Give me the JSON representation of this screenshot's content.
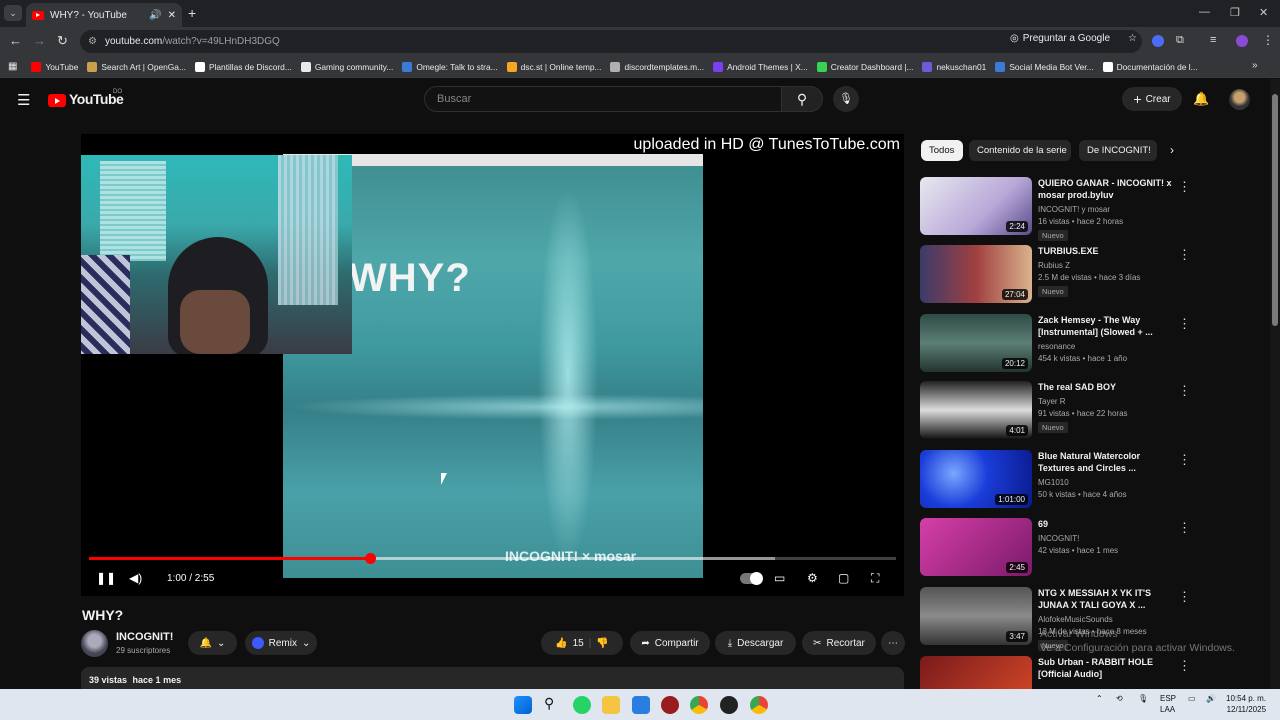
{
  "browser": {
    "tab_title": "WHY? - YouTube",
    "url_host": "youtube.com",
    "url_path": "/watch?v=49LHnDH3DGQ",
    "ask_google": "Preguntar a Google"
  },
  "bookmarks": [
    {
      "label": "YouTube",
      "color": "#ff0000"
    },
    {
      "label": "Search Art | OpenGa...",
      "color": "#c9a14a"
    },
    {
      "label": "Plantillas de Discord...",
      "color": "#ffffff"
    },
    {
      "label": "Gaming community...",
      "color": "#e8eaed"
    },
    {
      "label": "Omegle: Talk to stra...",
      "color": "#3a7bd5"
    },
    {
      "label": "dsc.st | Online temp...",
      "color": "#f5a623"
    },
    {
      "label": "discordtemplates.m...",
      "color": "#b0b0b0"
    },
    {
      "label": "Android Themes | X...",
      "color": "#7b3ff2"
    },
    {
      "label": "Creator Dashboard |...",
      "color": "#39d353"
    },
    {
      "label": "nekuschan01",
      "color": "#6b5bd6"
    },
    {
      "label": "Social Media Bot Ver...",
      "color": "#3a7bd5"
    },
    {
      "label": "Documentación de l...",
      "color": "#ffffff"
    }
  ],
  "youtube": {
    "logo_text": "YouTube",
    "logo_region": "DO",
    "search_placeholder": "Buscar",
    "create_label": "Crear"
  },
  "player": {
    "watermark": "uploaded in HD @ TunesToTube.com",
    "art_title": "WHY?",
    "art_credit": "INCOGNIT! × mosar",
    "time": "1:00 / 2:55",
    "progress_fraction": 0.348,
    "buffered_fraction": 0.85
  },
  "video": {
    "title": "WHY?",
    "channel": "INCOGNIT!",
    "subscribers": "29 suscriptores",
    "remix_label": "Remix",
    "likes": "15",
    "share_label": "Compartir",
    "download_label": "Descargar",
    "clip_label": "Recortar",
    "views": "39 vistas",
    "date": "hace 1 mes"
  },
  "chips": [
    "Todos",
    "Contenido de la serie",
    "De INCOGNIT!"
  ],
  "recommendations": [
    {
      "title": "QUIERO GANAR - INCOGNIT! x mosar prod.byluv",
      "channel": "INCOGNIT! y mosar",
      "stats": "16 vistas • hace 2 horas",
      "badge": "Nuevo",
      "duration": "2:24",
      "thumb": "linear-gradient(135deg,#e8e8f0,#b8a8d8 60%,#5a4a8a)"
    },
    {
      "title": "TURBIUS.EXE",
      "channel": "Rubius Z",
      "stats": "2.5 M de vistas • hace 3 días",
      "badge": "Nuevo",
      "duration": "27:04",
      "thumb": "linear-gradient(90deg,#3b3b6b,#a04040 50%,#d9b38c)"
    },
    {
      "title": "Zack Hemsey - The Way [Instrumental] (Slowed + ...",
      "channel": "resonance",
      "stats": "454 k vistas • hace 1 año",
      "badge": "",
      "duration": "20:12",
      "thumb": "linear-gradient(180deg,#2f4a44,#5c7f76 50%,#24332f)"
    },
    {
      "title": "The real SAD BOY",
      "channel": "Tayer R",
      "stats": "91 vistas • hace 22 horas",
      "badge": "Nuevo",
      "duration": "4:01",
      "thumb": "linear-gradient(180deg,#222,#ddd 50%,#111)"
    },
    {
      "title": "Blue Natural Watercolor Textures and Circles ...",
      "channel": "MG1010",
      "stats": "50 k vistas • hace 4 años",
      "badge": "",
      "duration": "1:01:00",
      "thumb": "radial-gradient(circle at 30% 40%,#7aa7ff,#1a3cd9 40%,#0a1a8a)"
    },
    {
      "title": "69",
      "channel": "INCOGNIT!",
      "stats": "42 vistas • hace 1 mes",
      "badge": "",
      "duration": "2:45",
      "thumb": "linear-gradient(135deg,#d63fa8,#7a1a6a)"
    },
    {
      "title": "NTG X MESSIAH X YK IT'S JUNAA X TALI GOYA X ...",
      "channel": "AlofokeMusicSounds",
      "stats": "13 M de vistas • hace 8 meses",
      "badge": "Nuevo",
      "duration": "3:47",
      "thumb": "linear-gradient(180deg,#555,#8a8a8a 50%,#333)"
    },
    {
      "title": "Sub Urban - RABBIT HOLE [Official Audio]",
      "channel": "",
      "stats": "",
      "badge": "",
      "duration": "",
      "thumb": "linear-gradient(135deg,#7a1a1a,#d94a2a)"
    }
  ],
  "windows": {
    "activate_title": "Activar Windows",
    "activate_sub": "Ve a Configuración para activar Windows.",
    "lang_1": "ESP",
    "lang_2": "LAA",
    "time": "10:54 p. m.",
    "date": "12/11/2025"
  }
}
